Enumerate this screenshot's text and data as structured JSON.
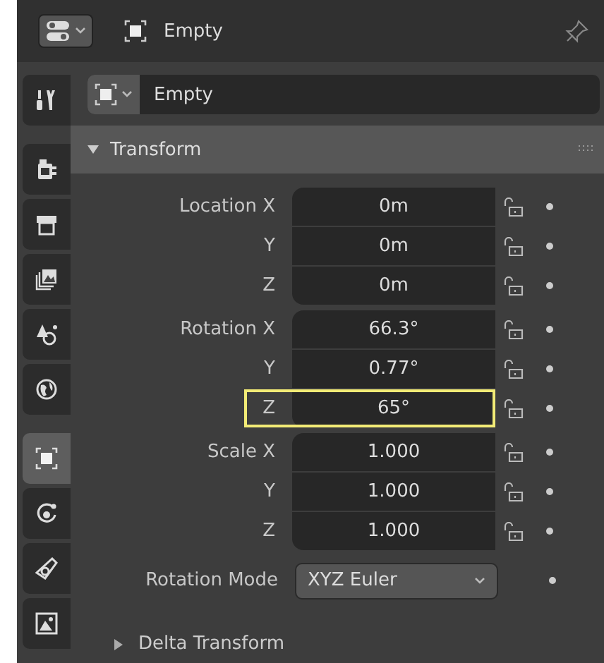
{
  "header": {
    "title": "Empty",
    "pinned": false
  },
  "object_field": {
    "value": "Empty"
  },
  "sidebar_tabs": [
    {
      "kind": "tool",
      "selected": false
    },
    {
      "kind": "render",
      "selected": false
    },
    {
      "kind": "output",
      "selected": false
    },
    {
      "kind": "view-layer",
      "selected": false
    },
    {
      "kind": "scene",
      "selected": false
    },
    {
      "kind": "world",
      "selected": false
    },
    {
      "kind": "object",
      "selected": true
    },
    {
      "kind": "physics",
      "selected": false
    },
    {
      "kind": "constraints",
      "selected": false
    },
    {
      "kind": "texture",
      "selected": false
    }
  ],
  "transform": {
    "title": "Transform",
    "expanded": true,
    "groups": [
      {
        "rows": [
          {
            "label": "Location X",
            "value": "0m",
            "highlighted": false
          },
          {
            "label": "Y",
            "value": "0m",
            "highlighted": false
          },
          {
            "label": "Z",
            "value": "0m",
            "highlighted": false
          }
        ]
      },
      {
        "rows": [
          {
            "label": "Rotation X",
            "value": "66.3°",
            "highlighted": false
          },
          {
            "label": "Y",
            "value": "0.77°",
            "highlighted": false
          },
          {
            "label": "Z",
            "value": "65°",
            "highlighted": true
          }
        ]
      },
      {
        "rows": [
          {
            "label": "Scale X",
            "value": "1.000",
            "highlighted": false
          },
          {
            "label": "Y",
            "value": "1.000",
            "highlighted": false
          },
          {
            "label": "Z",
            "value": "1.000",
            "highlighted": false
          }
        ]
      }
    ],
    "rotation_mode": {
      "label": "Rotation Mode",
      "value": "XYZ Euler"
    }
  },
  "delta_transform": {
    "title": "Delta Transform",
    "expanded": false
  }
}
